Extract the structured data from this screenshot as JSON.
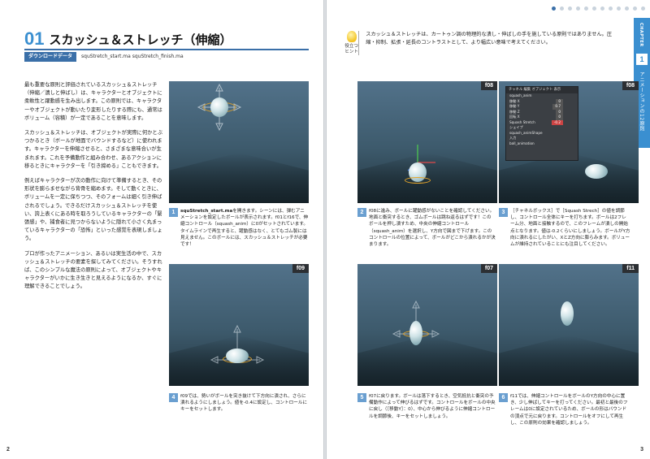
{
  "left_page": {
    "section_number": "01",
    "section_title": "スカッシュ＆ストレッチ（伸縮）",
    "download_label": "ダウンロードデータ",
    "download_files": "squStretch_start.ma   squStretch_finish.ma",
    "paragraphs": [
      "最も重要な原則と評価されているスカッシュ＆ストレッチ（伸縮／潰しと伸ばし）は、キャラクターとオブジェクトに柔軟性と躍動感を生み出します。この原則では、キャラクターやオブジェクトが動いたり変形したりする際にも、通常はボリューム（容積）が一定であることを意味します。",
      "スカッシュ＆ストレッチは、オブジェクトが実際に何かとぶつかるとき（ボールが地面でバウンドするなど）に使われます。キャラクターを伸縮させると、さまざまな意味合いが生まれます。これを予備動作と組み合わせ、あるアクションに移るときにキャラクターを「引き締める」こともできます。",
      "例えばキャラクターが次の動作に向けて準備するとき、その形状を膨らませながら背骨を縮めます。そして動くときに、ボリュームを一定に保ちつつ、そのフォームは細く引き伸ばされるでしょう。できるだけスカッシュ＆ストレッチを使い、誇上表くにある時を取ろうしているキャラクターの「緊張感」や、捕食者に見つからないように隠れて小さく丸まっているキャラクターの「恐怖」といった感覚を表現しましょう。",
      "プロが作ったアニメーション、あるいは実生活の中で、スカッシュ＆ストレッチの要素を探してみてください。そうすれば、このシンプルな魔法の原則によって、オブジェクトやキャラクターがいかに生き生きと見えるようになるか、すぐに理解できることでしょう。"
    ],
    "steps": [
      {
        "num": "1",
        "tag": "",
        "caption_bold": "squStretch_start.ma",
        "caption": "を開きます。シーンには、弾むアニメーションを設定したボールが表示されます。f01とf16で、伸縮コントロール（squash_anim）に0がセットされています。タイムラインで再生すると、躍動感はなく、とてもゴム製には見えません。このボールには、スカッシュ＆ストレッチが必要です！"
      },
      {
        "num": "4",
        "tag": "f09",
        "caption_bold": "",
        "caption": "f09では、勢いがボールを突き抜けて下方向に潰され、さらに潰れるようにしましょう。値を-0.4に設定し、コントロールにキーをセットします。"
      }
    ],
    "page_number": "2"
  },
  "right_page": {
    "hint_label": "役立つヒント",
    "hint_text": "スカッシュ＆ストレッチは、カートゥン調の物理的な潰し・伸ばしの手を施している原則ではありません。圧縮・抑制、拡張・延長のコントラストとして、より幅広い意味で考えてください。",
    "chapter_label": "CHAPTER",
    "chapter_number": "1",
    "chapter_name": "アニメーションの12原則",
    "channel_box": {
      "tabs": "チャネル  編集  オブジェクト  表示",
      "object": "squash_anim",
      "rows": [
        {
          "label": "移動 X",
          "value": "0"
        },
        {
          "label": "移動 Y",
          "value": "0.7"
        },
        {
          "label": "移動 Z",
          "value": "0"
        },
        {
          "label": "回転 X",
          "value": "0"
        },
        {
          "label": "Squash Stretch",
          "value": "-0.2"
        }
      ],
      "shapes": "シェイプ",
      "shape_name": "squash_animShape",
      "inputs": "入力",
      "input_name": "ball_animation"
    },
    "steps": [
      {
        "num": "2",
        "tag": "f08",
        "caption": "f08に進み、ボールに躍動感がないことを確認してください。地面と衝突するとき、ゴムボールは跳ね返るはずです！このボールを押し潰すため、中央の伸縮コントロール（squash_anim）を選択し、Y方向で図まで下げます。このコントロールの位置によって、ボールがどこから潰れるかが決まります。"
      },
      {
        "num": "3",
        "tag": "f08",
        "caption": "［チャネルボックス］で［Squash Strech］の値を調節し、コントロール全体にキーを打ちます。ボールは2フレーム分、地面と接触するので、このフレームが潰しの開始点となります。値は-0.2くらいにしましょう。ボールがY方向に潰れるにしたがい、XとZ方向に膨らみます。ボリュームが維持されていることにも注目してください。"
      },
      {
        "num": "5",
        "tag": "f07",
        "caption": "f07に戻ります。ボールは落下するとき、空気抵抗と衝突の予備動作によって伸びるはずです。コントロールをボールの中央に戻し（［移動Y］：0）、中心から伸びるように伸縮コントロールを調節後、キーをセットしましょう。"
      },
      {
        "num": "6",
        "tag": "f11",
        "caption": "f11では、伸縮コントロールをボールのY方向の中心に置き、少し伸ばしてキーを打ってください。最初と最後のフレームは0に設定されているため、ボールの形はバウンドの頂点で元に戻ります。コントロールをオフにして再生し、この原則の効果を確認しましょう。"
      }
    ],
    "page_number": "3"
  }
}
